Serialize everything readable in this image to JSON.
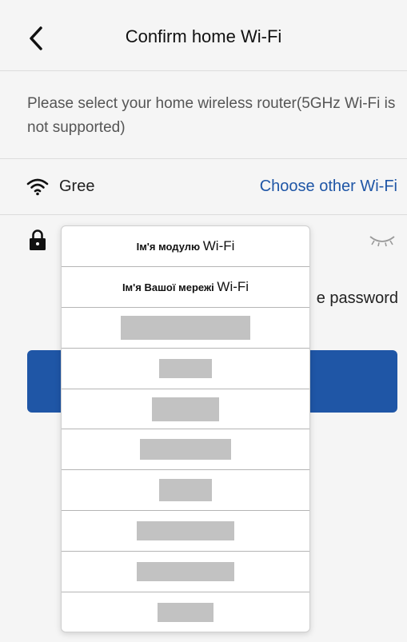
{
  "header": {
    "title": "Confirm home Wi-Fi"
  },
  "instruction": "Please select your home wireless router(5GHz Wi-Fi is not supported)",
  "wifi": {
    "name": "Gree",
    "choose_other": "Choose other Wi-Fi"
  },
  "password": {
    "placeholder": "",
    "remember_label_visible": "e password"
  },
  "next_button": {
    "label": "",
    "color": "#1f56a6"
  },
  "dropdown": {
    "items": [
      {
        "prefix": "Ім'я модулю ",
        "suffix": "Wi-Fi"
      },
      {
        "prefix": "Ім'я Вашої мережі ",
        "suffix": "Wi-Fi"
      }
    ],
    "redacted_count": 8
  },
  "colors": {
    "accent": "#1f56a6",
    "background": "#f5f5f5",
    "redaction": "#c2c2c2"
  }
}
